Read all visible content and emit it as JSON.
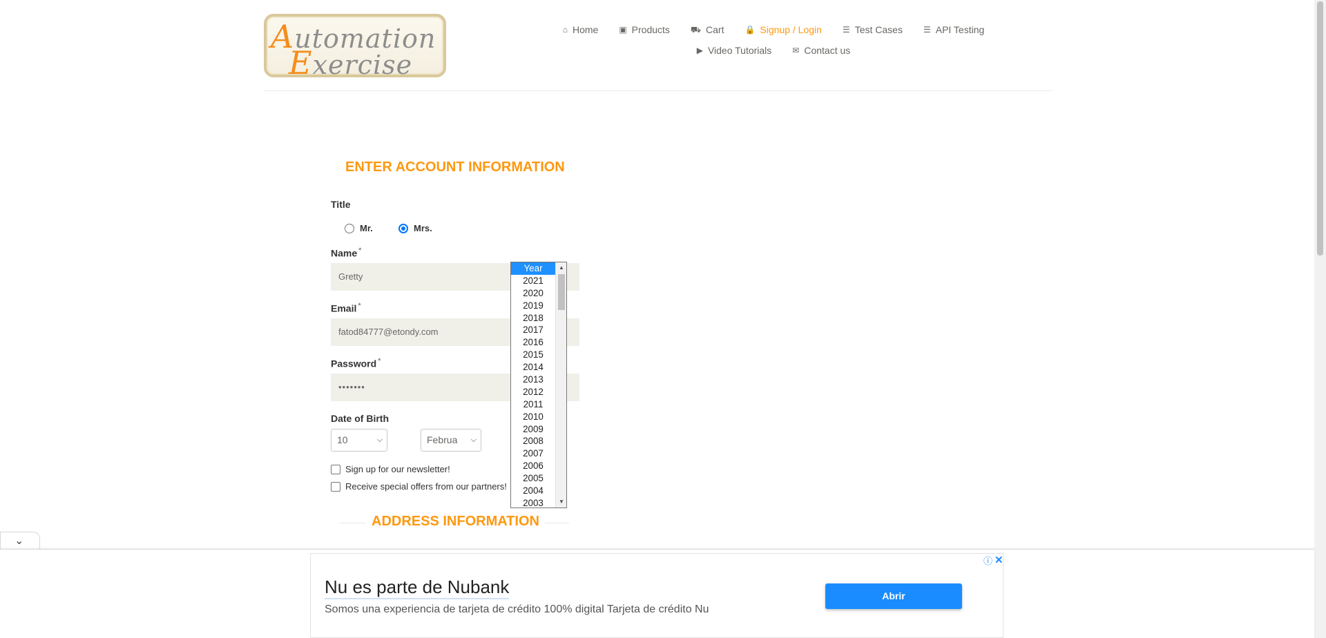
{
  "logo": {
    "line1_cap": "A",
    "line1_rest": "utomation",
    "line2_cap": "E",
    "line2_rest": "xercise"
  },
  "nav": {
    "row1": [
      {
        "label": "Home",
        "icon": "home-icon",
        "glyph": "⌂",
        "active": false
      },
      {
        "label": "Products",
        "icon": "products-icon",
        "glyph": "▣",
        "active": false
      },
      {
        "label": "Cart",
        "icon": "cart-icon",
        "glyph": "⛟",
        "active": false
      },
      {
        "label": "Signup / Login",
        "icon": "lock-icon",
        "glyph": "🔒",
        "active": true
      },
      {
        "label": "Test Cases",
        "icon": "list-icon",
        "glyph": "☰",
        "active": false
      },
      {
        "label": "API Testing",
        "icon": "list-icon",
        "glyph": "☰",
        "active": false
      }
    ],
    "row2": [
      {
        "label": "Video Tutorials",
        "icon": "youtube-icon",
        "glyph": "▶",
        "active": false
      },
      {
        "label": "Contact us",
        "icon": "envelope-icon",
        "glyph": "✉",
        "active": false
      }
    ]
  },
  "form": {
    "title": "ENTER ACCOUNT INFORMATION",
    "title_label": "Title",
    "title_options": [
      {
        "label": "Mr.",
        "checked": false
      },
      {
        "label": "Mrs.",
        "checked": true
      }
    ],
    "name_label": "Name",
    "name_value": "Gretty",
    "email_label": "Email",
    "email_value": "fatod84777@etondy.com",
    "password_label": "Password",
    "password_value": "•••••••",
    "required_mark": "*",
    "dob_label": "Date of Birth",
    "dob_day": "10",
    "dob_month": "Februa",
    "newsletter_label": "Sign up for our newsletter!",
    "offers_label": "Receive special offers from our partners!",
    "address_title": "ADDRESS INFORMATION"
  },
  "year_dropdown": {
    "selected": "Year",
    "options": [
      "Year",
      "2021",
      "2020",
      "2019",
      "2018",
      "2017",
      "2016",
      "2015",
      "2014",
      "2013",
      "2012",
      "2011",
      "2010",
      "2009",
      "2008",
      "2007",
      "2006",
      "2005",
      "2004",
      "2003"
    ]
  },
  "ad": {
    "title": "Nu es parte de Nubank",
    "description": "Somos una experiencia de tarjeta de crédito 100% digital Tarjeta de crédito Nu",
    "button_label": "Abrir",
    "info_glyph": "ⓘ",
    "close_glyph": "✕",
    "toggle_glyph": "⌄"
  },
  "colors": {
    "accent": "#fe980f",
    "ad_button": "#1a8cff",
    "input_bg": "#f0f0e9"
  }
}
